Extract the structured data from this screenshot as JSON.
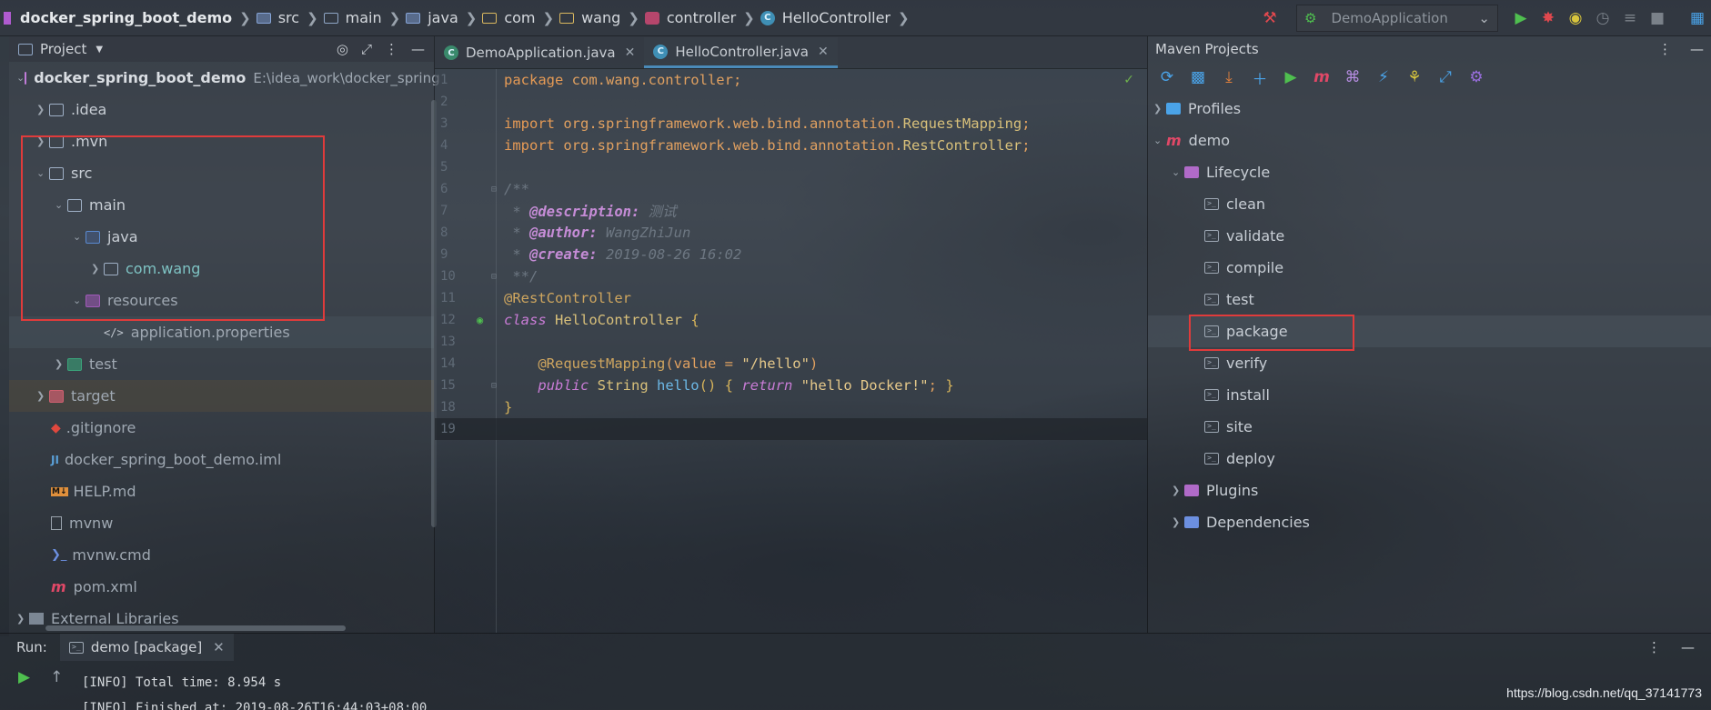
{
  "navbar": {
    "project": "docker_spring_boot_demo",
    "crumbs": [
      "src",
      "main",
      "java",
      "com",
      "wang",
      "controller",
      "HelloController"
    ],
    "run_config": "DemoApplication"
  },
  "project_panel": {
    "title": "Project",
    "items": [
      {
        "label": "docker_spring_boot_demo",
        "path": "E:\\idea_work\\docker_spring"
      },
      {
        "label": ".idea"
      },
      {
        "label": ".mvn"
      },
      {
        "label": "src"
      },
      {
        "label": "main"
      },
      {
        "label": "java"
      },
      {
        "label": "com.wang"
      },
      {
        "label": "resources"
      },
      {
        "label": "application.properties"
      },
      {
        "label": "test"
      },
      {
        "label": "target"
      },
      {
        "label": ".gitignore"
      },
      {
        "label": "docker_spring_boot_demo.iml"
      },
      {
        "label": "HELP.md"
      },
      {
        "label": "mvnw"
      },
      {
        "label": "mvnw.cmd"
      },
      {
        "label": "pom.xml"
      },
      {
        "label": "External Libraries"
      }
    ]
  },
  "editor": {
    "tabs": [
      "DemoApplication.java",
      "HelloController.java"
    ],
    "line_numbers": [
      "1",
      "2",
      "3",
      "4",
      "5",
      "6",
      "7",
      "8",
      "9",
      "10",
      "11",
      "12",
      "13",
      "14",
      "15",
      "18",
      "19"
    ],
    "code": {
      "l1_kw": "package",
      "l1_rest": " com.wang.controller;",
      "l3_kw": "import",
      "l3_pkg": " org.springframework.web.bind.annotation.",
      "l3_cls": "RequestMapping",
      "l4_kw": "import",
      "l4_pkg": " org.springframework.web.bind.annotation.",
      "l4_cls": "RestController",
      "l6": "/**",
      "l7_tag": "@description:",
      "l7_val": " 测试",
      "l8_tag": "@author:",
      "l8_val": " WangZhiJun",
      "l9_tag": "@create:",
      "l9_val": " 2019-08-26 16:02",
      "l10": " **/",
      "l11": "@RestController",
      "l12_kw": "class",
      "l12_name": " HelloController ",
      "l12_brace": "{",
      "l14_ann": "@RequestMapping",
      "l14_rest1": "(value = ",
      "l14_str": "\"/hello\"",
      "l14_rest2": ")",
      "l15_kw": "public",
      "l15_type": " String ",
      "l15_fn": "hello",
      "l15_rest": "() ",
      "l15_brace": "{",
      "l15_ret": " return ",
      "l15_str": "\"hello Docker!\"",
      "l15_end": "; ",
      "l15_brace2": "}",
      "l18": "}"
    }
  },
  "maven": {
    "title": "Maven Projects",
    "profiles": "Profiles",
    "project": "demo",
    "lifecycle": "Lifecycle",
    "goals": [
      "clean",
      "validate",
      "compile",
      "test",
      "package",
      "verify",
      "install",
      "site",
      "deploy"
    ],
    "plugins": "Plugins",
    "dependencies": "Dependencies"
  },
  "run": {
    "label": "Run:",
    "tab": "demo [package]",
    "lines": [
      "[INFO] Total time: 8.954 s",
      "[INFO] Finished at: 2019-08-26T16:44:03+08:00"
    ]
  },
  "watermark": "https://blog.csdn.net/qq_37141773"
}
